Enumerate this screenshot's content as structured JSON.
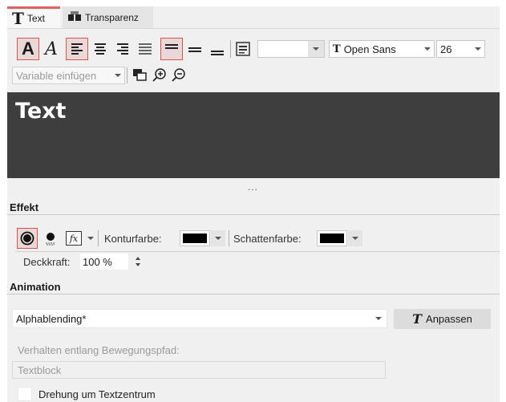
{
  "tabs": [
    {
      "label": "Text",
      "icon": "text-t-icon"
    },
    {
      "label": "Transparenz",
      "icon": "transparency-icon"
    }
  ],
  "toolbar": {
    "bold_glyph": "A",
    "italic_glyph": "A",
    "font_name": "Open Sans",
    "font_glyph": "T",
    "font_size": "26",
    "color_value": "",
    "variable_label": "Variable einfügen"
  },
  "preview": {
    "text": "Text",
    "more": "..."
  },
  "effekt": {
    "heading": "Effekt",
    "fx_glyph": "fx",
    "outline_label": "Konturfarbe:",
    "outline_color": "#000000",
    "shadow_label": "Schattenfarbe:",
    "shadow_color": "#000000",
    "opacity_label": "Deckkraft:",
    "opacity_value": "100 %"
  },
  "animation": {
    "heading": "Animation",
    "value": "Alphablending*",
    "adjust_label": "Anpassen",
    "adjust_glyph": "T",
    "path_label": "Verhalten entlang Bewegungspfad:",
    "path_value": "Textblock",
    "rotate_label": "Drehung um Textzentrum",
    "rotate_checked": false
  },
  "colors": {
    "accent": "#e05050",
    "preview_bg": "#3e3e3e"
  }
}
